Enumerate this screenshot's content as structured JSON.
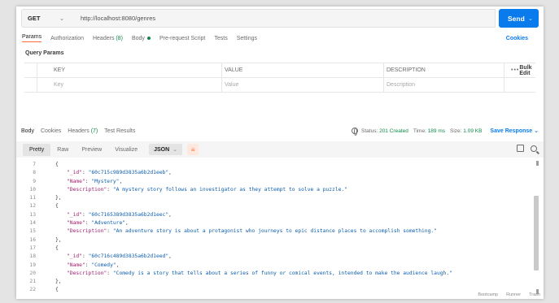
{
  "request": {
    "method": "GET",
    "url": "http://localhost:8080/genres",
    "send_label": "Send"
  },
  "req_tabs": {
    "params": "Params",
    "authorization": "Authorization",
    "headers": "Headers",
    "headers_count": "(8)",
    "body": "Body",
    "prerequest": "Pre-request Script",
    "tests": "Tests",
    "settings": "Settings",
    "cookies": "Cookies"
  },
  "query_params": {
    "title": "Query Params",
    "headers": {
      "key": "KEY",
      "value": "VALUE",
      "description": "DESCRIPTION",
      "bulk_edit": "Bulk Edit",
      "more": "•••"
    },
    "placeholders": {
      "key": "Key",
      "value": "Value",
      "description": "Description"
    }
  },
  "response": {
    "tabs": {
      "body": "Body",
      "cookies": "Cookies",
      "headers": "Headers",
      "headers_count": "(7)",
      "test_results": "Test Results"
    },
    "status_label": "Status:",
    "status_value": "201 Created",
    "time_label": "Time:",
    "time_value": "189 ms",
    "size_label": "Size:",
    "size_value": "1.09 KB",
    "save_response": "Save Response"
  },
  "toolbar": {
    "pretty": "Pretty",
    "raw": "Raw",
    "preview": "Preview",
    "visualize": "Visualize",
    "format": "JSON"
  },
  "code_lines": [
    {
      "n": "7",
      "indent": 0,
      "parts": [
        {
          "c": "p",
          "t": "{"
        }
      ]
    },
    {
      "n": "8",
      "indent": 1,
      "parts": [
        {
          "c": "k",
          "t": "\"_id\""
        },
        {
          "c": "p",
          "t": ": "
        },
        {
          "c": "s",
          "t": "\"60c715c989d3835a6b2d1eeb\""
        },
        {
          "c": "p",
          "t": ","
        }
      ]
    },
    {
      "n": "9",
      "indent": 1,
      "parts": [
        {
          "c": "k",
          "t": "\"Name\""
        },
        {
          "c": "p",
          "t": ": "
        },
        {
          "c": "s",
          "t": "\"Mystery\""
        },
        {
          "c": "p",
          "t": ","
        }
      ]
    },
    {
      "n": "10",
      "indent": 1,
      "parts": [
        {
          "c": "k",
          "t": "\"Description\""
        },
        {
          "c": "p",
          "t": ": "
        },
        {
          "c": "s",
          "t": "\"A mystery story follows an investigator as they attempt to solve a puzzle.\""
        }
      ]
    },
    {
      "n": "11",
      "indent": 0,
      "parts": [
        {
          "c": "p",
          "t": "},"
        }
      ]
    },
    {
      "n": "12",
      "indent": 0,
      "parts": [
        {
          "c": "p",
          "t": "{"
        }
      ]
    },
    {
      "n": "13",
      "indent": 1,
      "parts": [
        {
          "c": "k",
          "t": "\"_id\""
        },
        {
          "c": "p",
          "t": ": "
        },
        {
          "c": "s",
          "t": "\"60c7165389d3835a6b2d1eec\""
        },
        {
          "c": "p",
          "t": ","
        }
      ]
    },
    {
      "n": "14",
      "indent": 1,
      "parts": [
        {
          "c": "k",
          "t": "\"Name\""
        },
        {
          "c": "p",
          "t": ": "
        },
        {
          "c": "s",
          "t": "\"Adventure\""
        },
        {
          "c": "p",
          "t": ","
        }
      ]
    },
    {
      "n": "15",
      "indent": 1,
      "parts": [
        {
          "c": "k",
          "t": "\"Description\""
        },
        {
          "c": "p",
          "t": ": "
        },
        {
          "c": "s",
          "t": "\"An adventure story is about a protagonist who journeys to epic distance places to accomplish something.\""
        }
      ]
    },
    {
      "n": "16",
      "indent": 0,
      "parts": [
        {
          "c": "p",
          "t": "},"
        }
      ]
    },
    {
      "n": "17",
      "indent": 0,
      "parts": [
        {
          "c": "p",
          "t": "{"
        }
      ]
    },
    {
      "n": "18",
      "indent": 1,
      "parts": [
        {
          "c": "k",
          "t": "\"_id\""
        },
        {
          "c": "p",
          "t": ": "
        },
        {
          "c": "s",
          "t": "\"60c716c489d3835a6b2d1eed\""
        },
        {
          "c": "p",
          "t": ","
        }
      ]
    },
    {
      "n": "19",
      "indent": 1,
      "parts": [
        {
          "c": "k",
          "t": "\"Name\""
        },
        {
          "c": "p",
          "t": ": "
        },
        {
          "c": "s",
          "t": "\"Comedy\""
        },
        {
          "c": "p",
          "t": ","
        }
      ]
    },
    {
      "n": "20",
      "indent": 1,
      "parts": [
        {
          "c": "k",
          "t": "\"Description\""
        },
        {
          "c": "p",
          "t": ": "
        },
        {
          "c": "s",
          "t": "\"Comedy is a story that tells about a series of funny or comical events, intended to make the audience laugh.\""
        }
      ]
    },
    {
      "n": "21",
      "indent": 0,
      "parts": [
        {
          "c": "p",
          "t": "},"
        }
      ]
    },
    {
      "n": "22",
      "indent": 0,
      "parts": [
        {
          "c": "p",
          "t": "{"
        }
      ]
    }
  ],
  "statusbar": {
    "bootcamp": "Bootcamp",
    "runner": "Runner",
    "trash": "Trash"
  },
  "colors": {
    "accent": "#097bed",
    "orange": "#ff6c37",
    "green": "#0d8a4a",
    "json_key": "#a11e6d",
    "json_string": "#0f5fad"
  },
  "icons": [
    "chevron-down-icon",
    "globe-icon",
    "wrap-lines-icon",
    "copy-icon",
    "search-icon"
  ]
}
